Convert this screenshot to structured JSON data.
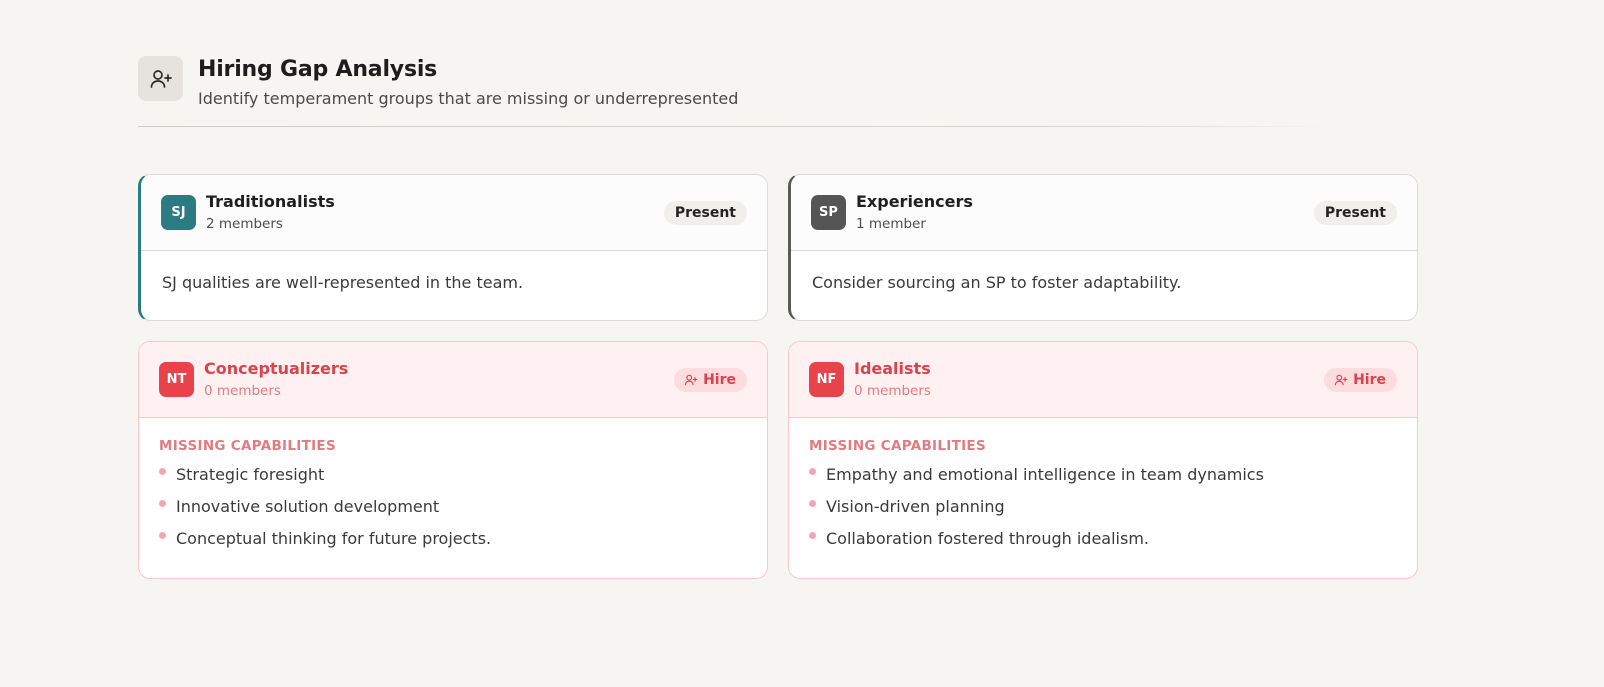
{
  "header": {
    "icon": "user-plus-icon",
    "title": "Hiring Gap Analysis",
    "subtitle": "Identify temperament groups that are missing or underrepresented"
  },
  "groups": [
    {
      "code": "SJ",
      "name": "Traditionalists",
      "count": "2 members",
      "status": "Present",
      "note": "SJ qualities are well-represented in the team.",
      "color": "#2c7a82"
    },
    {
      "code": "SP",
      "name": "Experiencers",
      "count": "1 member",
      "status": "Present",
      "note": "Consider sourcing an SP to foster adaptability.",
      "color": "#555555"
    },
    {
      "code": "NT",
      "name": "Conceptualizers",
      "count": "0 members",
      "status": "Hire",
      "missing_heading": "MISSING CAPABILITIES",
      "capabilities": [
        "Strategic foresight",
        "Innovative solution development",
        "Conceptual thinking for future projects."
      ],
      "color": "#e8424a"
    },
    {
      "code": "NF",
      "name": "Idealists",
      "count": "0 members",
      "status": "Hire",
      "missing_heading": "MISSING CAPABILITIES",
      "capabilities": [
        "Empathy and emotional intelligence in team dynamics",
        "Vision-driven planning",
        "Collaboration fostered through idealism."
      ],
      "color": "#e8424a"
    }
  ]
}
